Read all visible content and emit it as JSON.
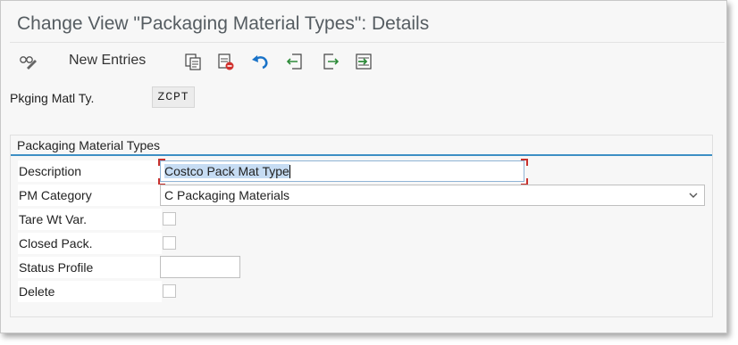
{
  "window": {
    "title": "Change View \"Packaging Material Types\": Details"
  },
  "toolbar": {
    "new_entries_label": "New Entries",
    "icons": [
      "display-change-icon",
      "copy-icon",
      "delete-icon",
      "undo-icon",
      "previous-entry-icon",
      "next-entry-icon",
      "select-icon"
    ]
  },
  "key": {
    "label": "Pkging Matl Ty.",
    "value": "ZCPT"
  },
  "group": {
    "title": "Packaging Material Types",
    "description": {
      "label": "Description",
      "value": "Costco Pack Mat Type"
    },
    "pm_category": {
      "label": "PM Category",
      "value": "C Packaging Materials"
    },
    "tare_wt_var": {
      "label": "Tare Wt Var.",
      "checked": false
    },
    "closed_pack": {
      "label": "Closed Pack.",
      "checked": false
    },
    "status_profile": {
      "label": "Status Profile",
      "value": ""
    },
    "delete": {
      "label": "Delete",
      "checked": false
    }
  },
  "colors": {
    "accent_line": "#3d8fc4",
    "selection": "#c6dcf3",
    "error_corner": "#c8322e",
    "icon_blue": "#1a73c8",
    "icon_green": "#2e8b3a",
    "icon_red": "#d0312d"
  }
}
